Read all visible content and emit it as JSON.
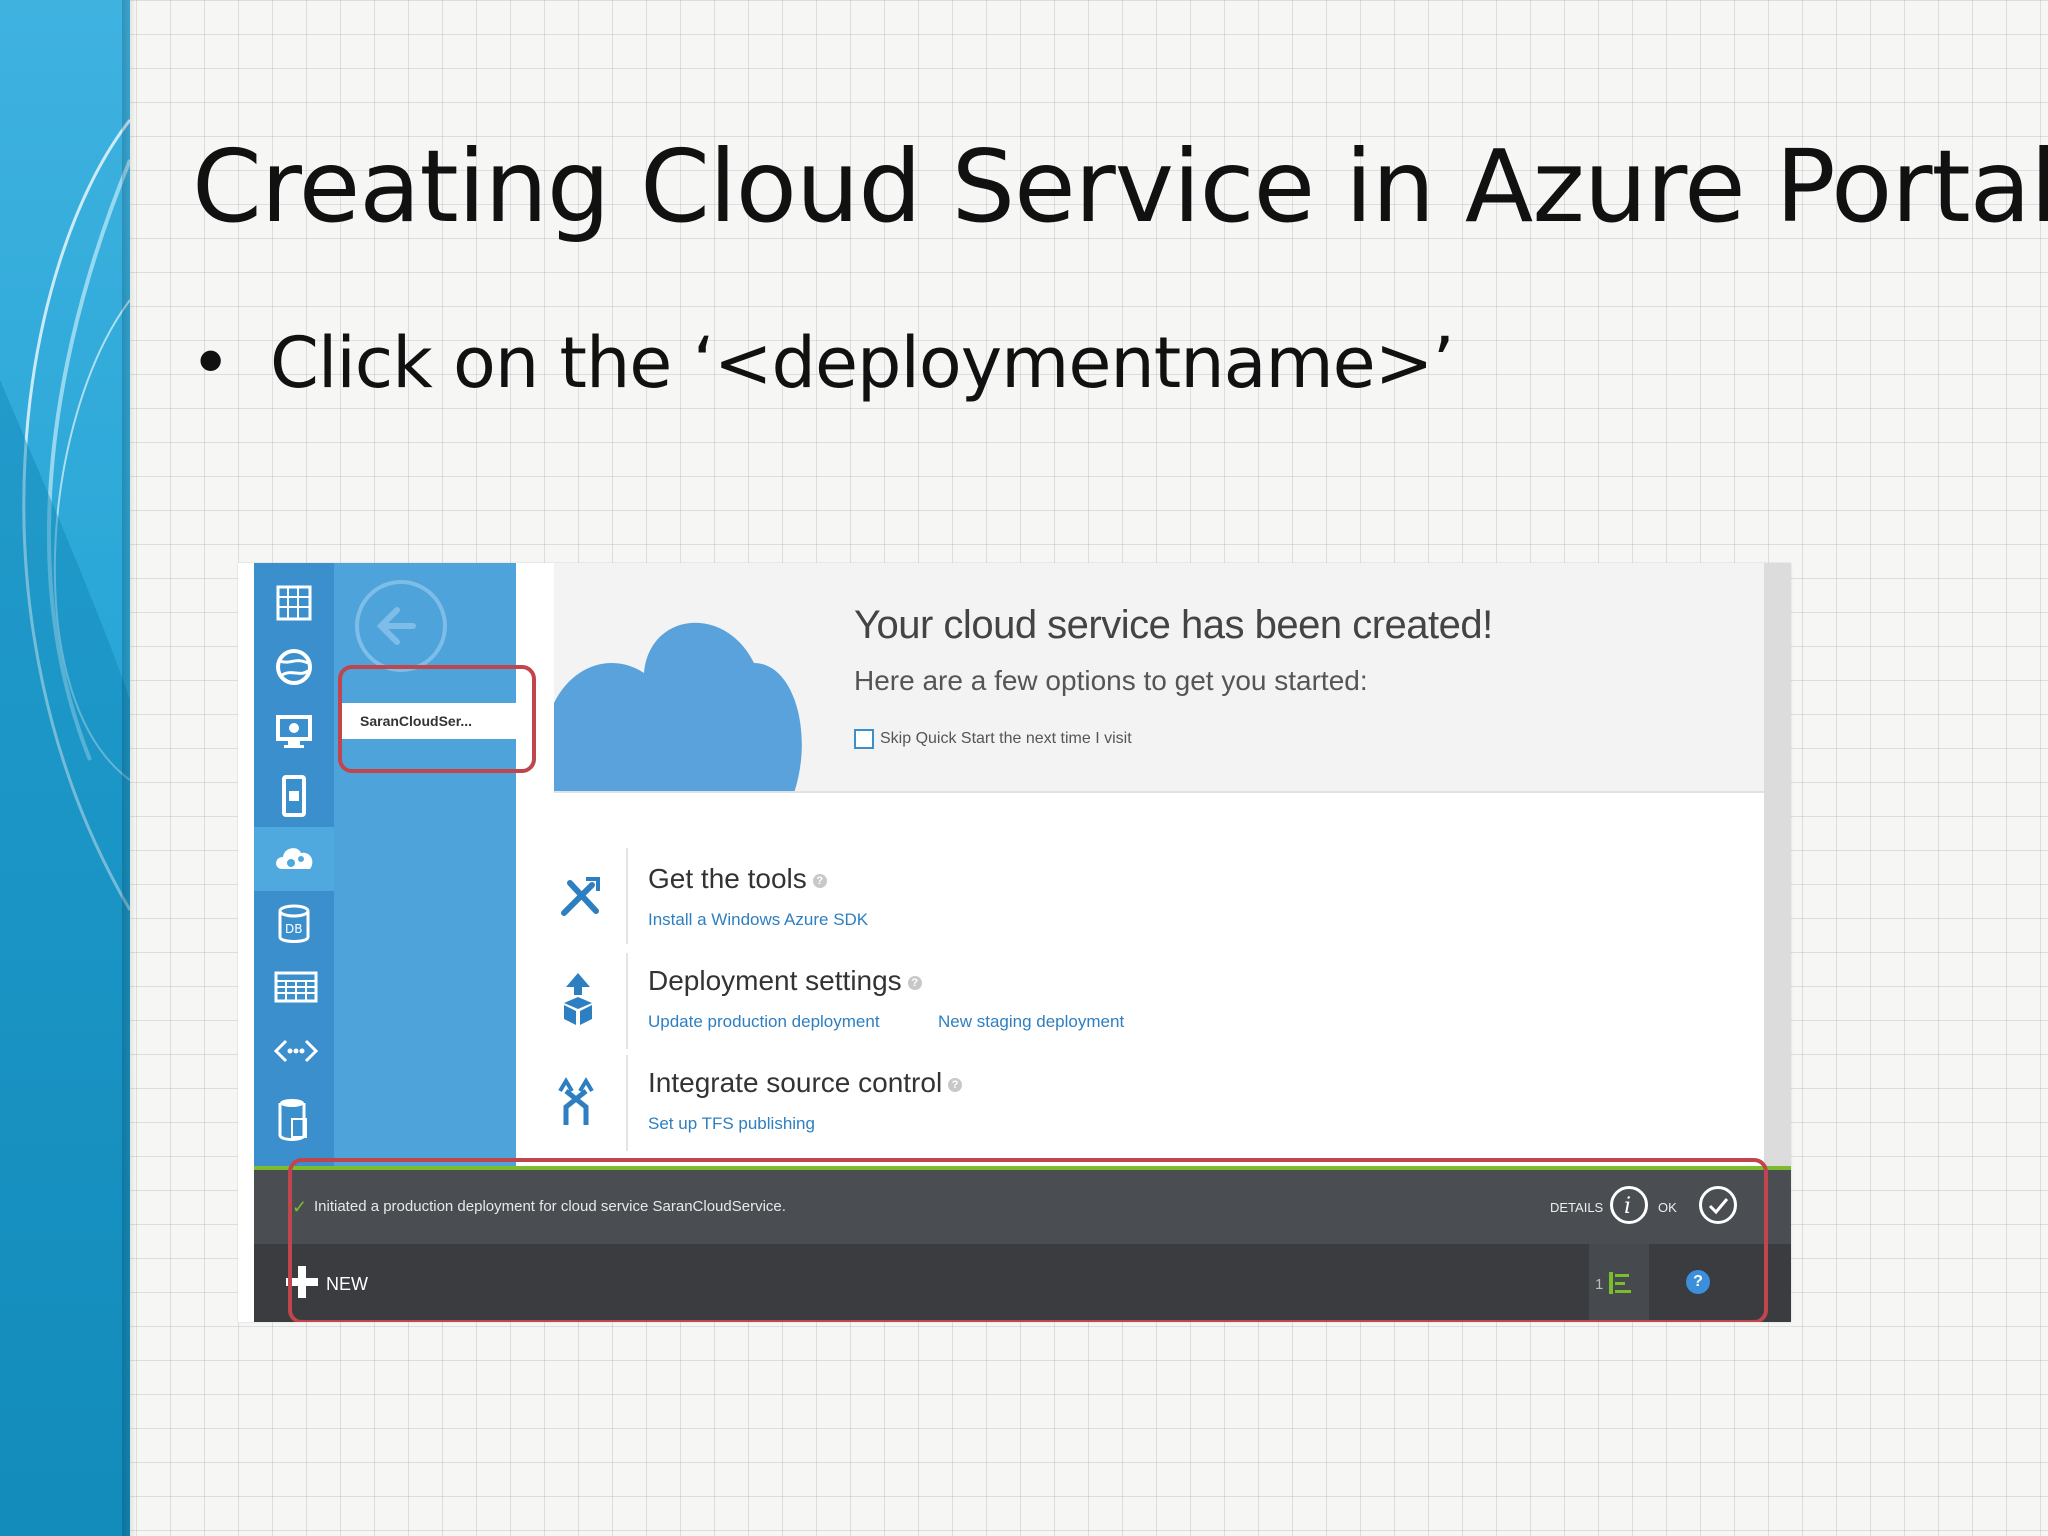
{
  "slide": {
    "title": "Creating Cloud Service in Azure Portal",
    "bullet_char": "•",
    "bullet_text": "Click on the ‘<deploymentname>’"
  },
  "portal": {
    "service_name": "SaranCloudSer...",
    "hero": {
      "title": "Your cloud service has been created!",
      "subtitle": "Here are a few options to get you started:",
      "skip_checkbox_label": "Skip Quick Start the next time I visit",
      "skip_checked": false
    },
    "quickstart": [
      {
        "title": "Get the tools",
        "help": "?",
        "links": [
          "Install a Windows Azure SDK"
        ],
        "icon": "tools-icon"
      },
      {
        "title": "Deployment settings",
        "help": "?",
        "links": [
          "Update production deployment",
          "New staging deployment"
        ],
        "icon": "deploy-icon"
      },
      {
        "title": "Integrate source control",
        "help": "?",
        "links": [
          "Set up TFS publishing"
        ],
        "icon": "source-control-icon"
      }
    ],
    "notification": {
      "message": "Initiated a production deployment for cloud service SaranCloudService.",
      "details_label": "DETAILS",
      "ok_label": "OK"
    },
    "command_bar": {
      "new_label": "NEW",
      "badge_count": "1",
      "help_label": "?"
    },
    "nav_icons": [
      "all-items-icon",
      "web-sites-icon",
      "virtual-machines-icon",
      "mobile-services-icon",
      "cloud-services-icon",
      "sql-databases-icon",
      "storage-icon",
      "media-services-icon",
      "service-bus-icon"
    ],
    "colors": {
      "nav_strip": "#3b8fcc",
      "nav_panel": "#4ea3db",
      "link": "#2d7fc1",
      "notification_bar": "#4a4d52",
      "command_bar": "#3a3c40",
      "highlight": "#c0454c",
      "success_green": "#7cbd2d"
    }
  }
}
